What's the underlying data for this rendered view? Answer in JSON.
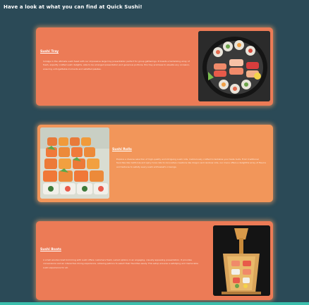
{
  "page": {
    "heading": "Have a look at what you can find at Quick Sushi!"
  },
  "cards": [
    {
      "title": "Sushi Tray",
      "description": "Indulge in the ultimate sushi feast with our impressive large tray presentation perfect for group gatherings. It boasts a tantalizing array of fresh, expertly crafted sushi delights, able to be arranged presentation and generous portions, this tray promises to elevate any occasion, ensuring unforgettable moments and satisfied palates.",
      "image_icon": "sushi-tray-image"
    },
    {
      "title": "Sushi Rolls",
      "description": "Explore a diverse selection of high-quality and intriguing sushi rolls, meticulously crafted to tantalize your taste buds. From traditional favorites like California and spicy tuna rolls to innovative creations like dragon and rainbow rolls, our menu offers a delightful array of flavors and textures to satisfy every sushi enthusiast's cravings.",
      "image_icon": "sushi-rolls-image"
    },
    {
      "title": "Sushi Boats",
      "description": "A small wooden boat brimming with sushi offers customers fresh, varied options in an engaging, visually appealing presentation. It provides convenience and an interactive dining experience, allowing patrons to select their favorites easily. This setup ensures a satisfying and memorable sushi experience for all.",
      "image_icon": "sushi-boat-image"
    }
  ],
  "colors": {
    "background": "#2b4a57",
    "card_primary": "#ec7b56",
    "card_secondary": "#f2965a",
    "accent_strip": "#3cbfad"
  }
}
